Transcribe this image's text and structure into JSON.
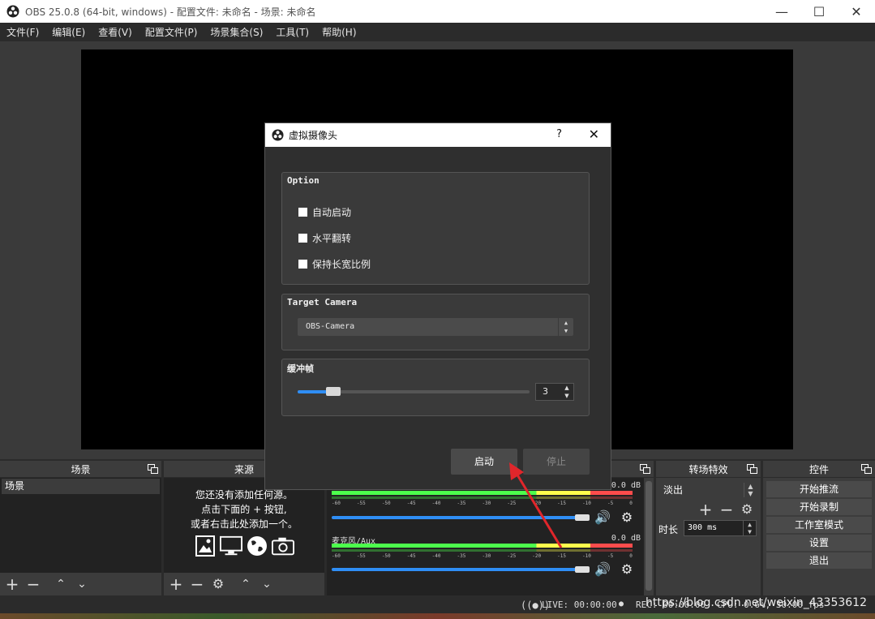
{
  "window": {
    "title": "OBS 25.0.8 (64-bit, windows) - 配置文件: 未命名 - 场景: 未命名",
    "min_icon": "minimize-icon",
    "max_icon": "maximize-icon",
    "close_icon": "close-icon"
  },
  "menu": [
    "文件(F)",
    "编辑(E)",
    "查看(V)",
    "配置文件(P)",
    "场景集合(S)",
    "工具(T)",
    "帮助(H)"
  ],
  "docks": {
    "scenes": {
      "title": "场景",
      "items": [
        "场景"
      ]
    },
    "sources": {
      "title": "来源",
      "empty_lines": [
        "您还没有添加任何源。",
        "点击下面的 + 按钮,",
        "或者右击此处添加一个。"
      ]
    },
    "mixer": {
      "channels": [
        {
          "name": "",
          "db": "0.0 dB"
        },
        {
          "name": "麦克风/Aux",
          "db": "0.0 dB"
        }
      ],
      "scale": [
        "-60",
        "-55",
        "-50",
        "-45",
        "-40",
        "-35",
        "-30",
        "-25",
        "-20",
        "-15",
        "-10",
        "-5",
        "0"
      ]
    },
    "transitions": {
      "title": "转场特效",
      "selected": "淡出",
      "duration_label": "时长",
      "duration_value": "300 ms"
    },
    "controls": {
      "title": "控件",
      "buttons": [
        "开始推流",
        "开始录制",
        "工作室模式",
        "设置",
        "退出"
      ]
    }
  },
  "status": {
    "live": "LIVE: 00:00:00",
    "rec": "REC: 00:00:00",
    "cpu": "CPU: 0.6%, 30.00 fps"
  },
  "watermark": "https://blog.csdn.net/weixin_43353612",
  "dialog": {
    "title": "虚拟摄像头",
    "help": "?",
    "option_title": "Option",
    "options": [
      "自动启动",
      "水平翻转",
      "保持长宽比例"
    ],
    "target_title": "Target Camera",
    "camera": "OBS-Camera",
    "buffer_title": "缓冲帧",
    "buffer_value": "3",
    "buffer_fraction": 0.13,
    "start": "启动",
    "stop": "停止"
  },
  "colors": {
    "accent": "#2f8ef5",
    "arrow": "#e0262b"
  }
}
